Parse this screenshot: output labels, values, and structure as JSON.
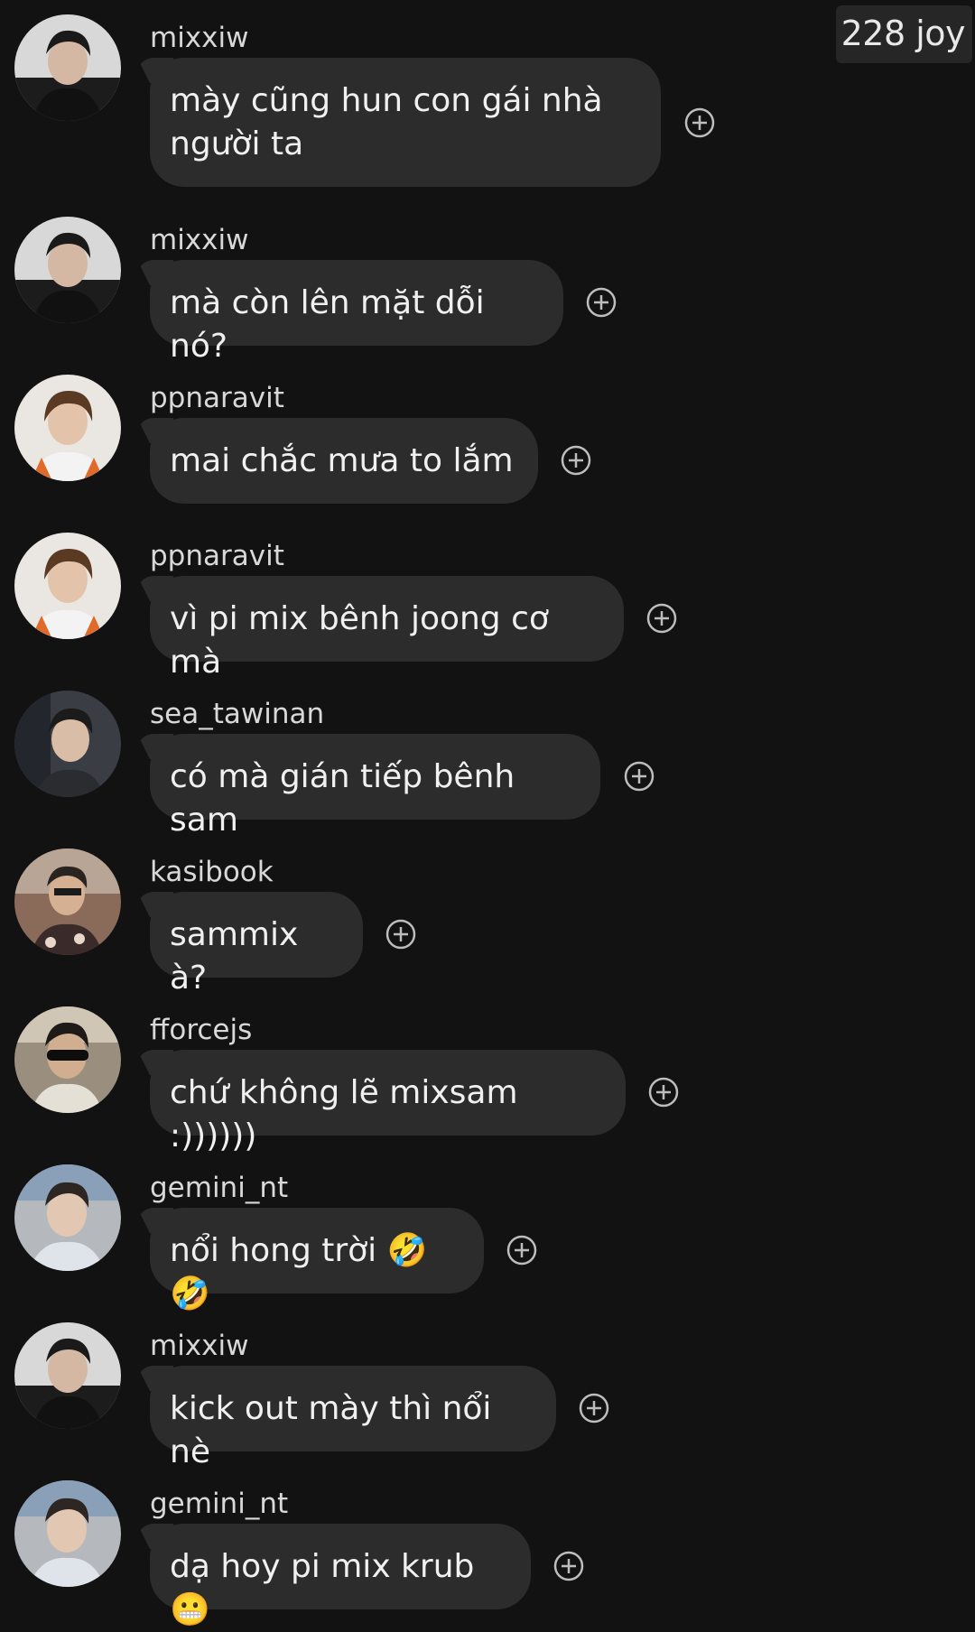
{
  "watermark": "228 joy",
  "messages": [
    {
      "username": "mixxiw",
      "text": "mày cũng hun con gái nhà người ta",
      "avatar": "mixxiw"
    },
    {
      "username": "mixxiw",
      "text": "mà còn lên mặt dỗi nó?",
      "avatar": "mixxiw"
    },
    {
      "username": "ppnaravit",
      "text": "mai chắc mưa to lắm",
      "avatar": "ppnaravit"
    },
    {
      "username": "ppnaravit",
      "text": "vì pi mix bênh joong cơ mà",
      "avatar": "ppnaravit"
    },
    {
      "username": "sea_tawinan",
      "text": "có mà gián tiếp bênh sam",
      "avatar": "sea_tawinan"
    },
    {
      "username": "kasibook",
      "text": "sammix à?",
      "avatar": "kasibook"
    },
    {
      "username": "fforcejs",
      "text": "chứ không lẽ mixsam :))))))",
      "avatar": "fforcejs"
    },
    {
      "username": "gemini_nt",
      "text": "nổi hong trời 🤣🤣",
      "avatar": "gemini_nt"
    },
    {
      "username": "mixxiw",
      "text": "kick out mày thì nổi nè",
      "avatar": "mixxiw"
    },
    {
      "username": "gemini_nt",
      "text": "dạ hoy pi mix krub 😬",
      "avatar": "gemini_nt"
    }
  ],
  "icons": {
    "reaction": "add-reaction-icon"
  },
  "colors": {
    "background": "#121212",
    "bubble": "#2c2c2c",
    "text": "#f0f0f0",
    "username": "#d8d8d8"
  }
}
